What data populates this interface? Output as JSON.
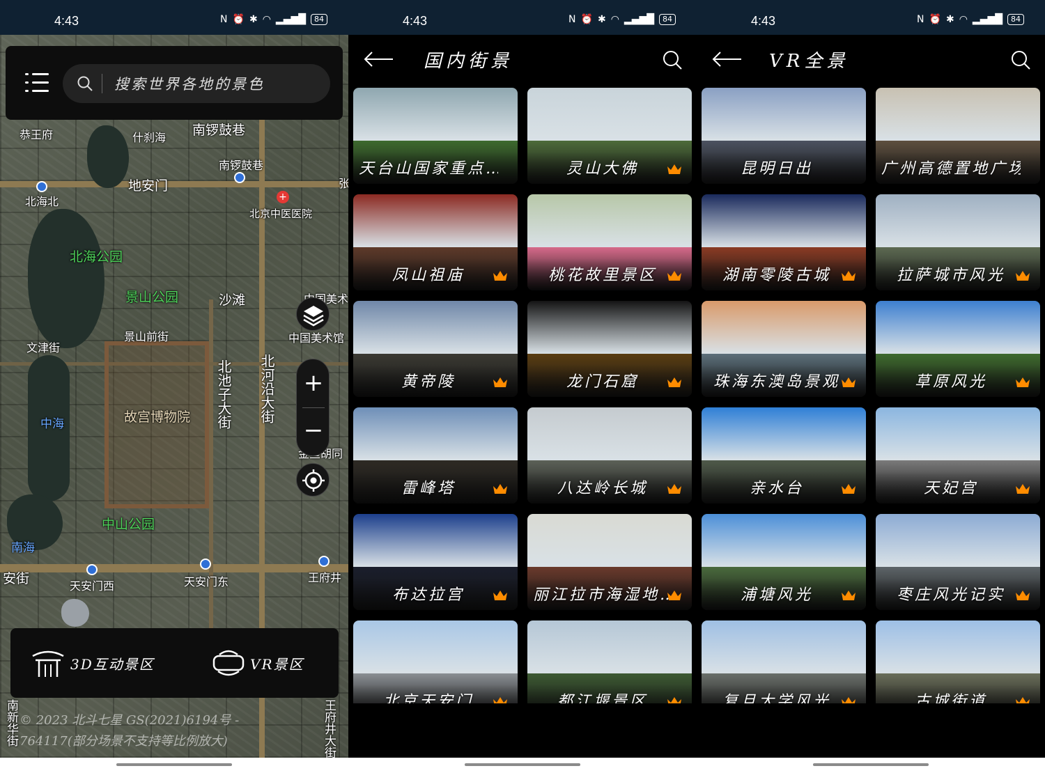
{
  "status": {
    "time": "4:43",
    "battery": "84",
    "icons": [
      "nfc-icon",
      "alarm-icon",
      "vibrate-icon",
      "wifi-icon",
      "signal-icon",
      "battery-icon"
    ]
  },
  "map": {
    "search_placeholder": "搜索世界各地的景色",
    "labels": {
      "gongwangfu": "恭王府",
      "shichahai": "什刹海",
      "nanluoguxiang": "南锣鼓巷",
      "nanluoguxiang_station": "南锣鼓巷",
      "dianmen": "地安门",
      "zhang": "张",
      "beihaibei": "北海北",
      "zhongyi_hospital": "北京中医医院",
      "beihai_park": "北海公园",
      "jingshan_park": "景山公园",
      "shatan": "沙滩",
      "art_museum_top": "中国美术",
      "art_museum": "中国美术馆",
      "wenjin_street": "文津街",
      "jingshan_front": "景山前街",
      "beichizi": "北池子大街",
      "beiheyan": "北河沿大街",
      "palace_museum": "故宫博物院",
      "zhonghai": "中海",
      "jinyu_hutong": "金鱼胡同",
      "zhongshan_park": "中山公园",
      "nanhai": "南海",
      "xichang_street": "安街",
      "tiananmen_west": "天安门西",
      "tiananmen_east": "天安门东",
      "wangfujing": "王府井",
      "bottom_left": "南新华街",
      "bottom_right": "王府井大街"
    },
    "mode_3d_label": "3D互动景区",
    "mode_vr_label": "VR景区",
    "copyright_line1": "© 2023 北斗七星 GS(2021)6194号 -",
    "copyright_line2": "764117(部分场景不支持等比例放大)"
  },
  "domestic": {
    "title": "国内街景",
    "items": [
      {
        "title": "天台山国家重点…",
        "crown": false,
        "sky": "#8fa7b0",
        "ground": "#3d6a2e"
      },
      {
        "title": "灵山大佛",
        "crown": true,
        "sky": "#c9d4da",
        "ground": "#4d6b3a"
      },
      {
        "title": "凤山祖庙",
        "crown": true,
        "sky": "#8b2a22",
        "ground": "#5e3a2a"
      },
      {
        "title": "桃花故里景区",
        "crown": true,
        "sky": "#b7c7a8",
        "ground": "#d66a8a"
      },
      {
        "title": "黄帝陵",
        "crown": true,
        "sky": "#6f87a8",
        "ground": "#3b3a33"
      },
      {
        "title": "龙门石窟",
        "crown": true,
        "sky": "#141414",
        "ground": "#5a3d12"
      },
      {
        "title": "雷峰塔",
        "crown": true,
        "sky": "#6e8fb8",
        "ground": "#2e2a24"
      },
      {
        "title": "八达岭长城",
        "crown": true,
        "sky": "#c5cbcf",
        "ground": "#5c6158"
      },
      {
        "title": "布达拉宫",
        "crown": true,
        "sky": "#1c3f8c",
        "ground": "#1a1e2c"
      },
      {
        "title": "丽江拉市海湿地…",
        "crown": true,
        "sky": "#d9dad3",
        "ground": "#6a3a2c"
      },
      {
        "title": "北京天安门",
        "crown": true,
        "sky": "#a9c7e6",
        "ground": "#8a8f93"
      },
      {
        "title": "都江堰景区",
        "crown": true,
        "sky": "#b5c7d6",
        "ground": "#3d5a33"
      }
    ]
  },
  "vr": {
    "title": "VR全景",
    "items": [
      {
        "title": "昆明日出",
        "crown": false,
        "sky": "#8aa0c3",
        "ground": "#4c5260"
      },
      {
        "title": "广州高德置地广场",
        "crown": false,
        "sky": "#c8c1b2",
        "ground": "#5d4f3f"
      },
      {
        "title": "湖南零陵古城",
        "crown": true,
        "sky": "#1a2a5c",
        "ground": "#8a3b24"
      },
      {
        "title": "拉萨城市风光",
        "crown": true,
        "sky": "#9fb0c2",
        "ground": "#5d6a52"
      },
      {
        "title": "珠海东澳岛景观",
        "crown": true,
        "sky": "#d99a6a",
        "ground": "#5c6f7a"
      },
      {
        "title": "草原风光",
        "crown": true,
        "sky": "#3d7fd0",
        "ground": "#3f6a2e"
      },
      {
        "title": "亲水台",
        "crown": true,
        "sky": "#2f7fd6",
        "ground": "#4f5a4a"
      },
      {
        "title": "天妃宫",
        "crown": true,
        "sky": "#8bb6e0",
        "ground": "#7a7a7a"
      },
      {
        "title": "浦塘风光",
        "crown": true,
        "sky": "#4c8fd8",
        "ground": "#4a6a3d"
      },
      {
        "title": "枣庄风光记实",
        "crown": true,
        "sky": "#8cabd4",
        "ground": "#5d6468"
      },
      {
        "title": "复旦大学风光",
        "crown": true,
        "sky": "#9fbfe3",
        "ground": "#6a6f6a"
      },
      {
        "title": "古城街道",
        "crown": true,
        "sky": "#9dbfe6",
        "ground": "#6a6e5a"
      }
    ]
  },
  "colors": {
    "crown": "#ff8c00",
    "status_bar": "#0f2132",
    "panel": "#0d0d0d"
  }
}
